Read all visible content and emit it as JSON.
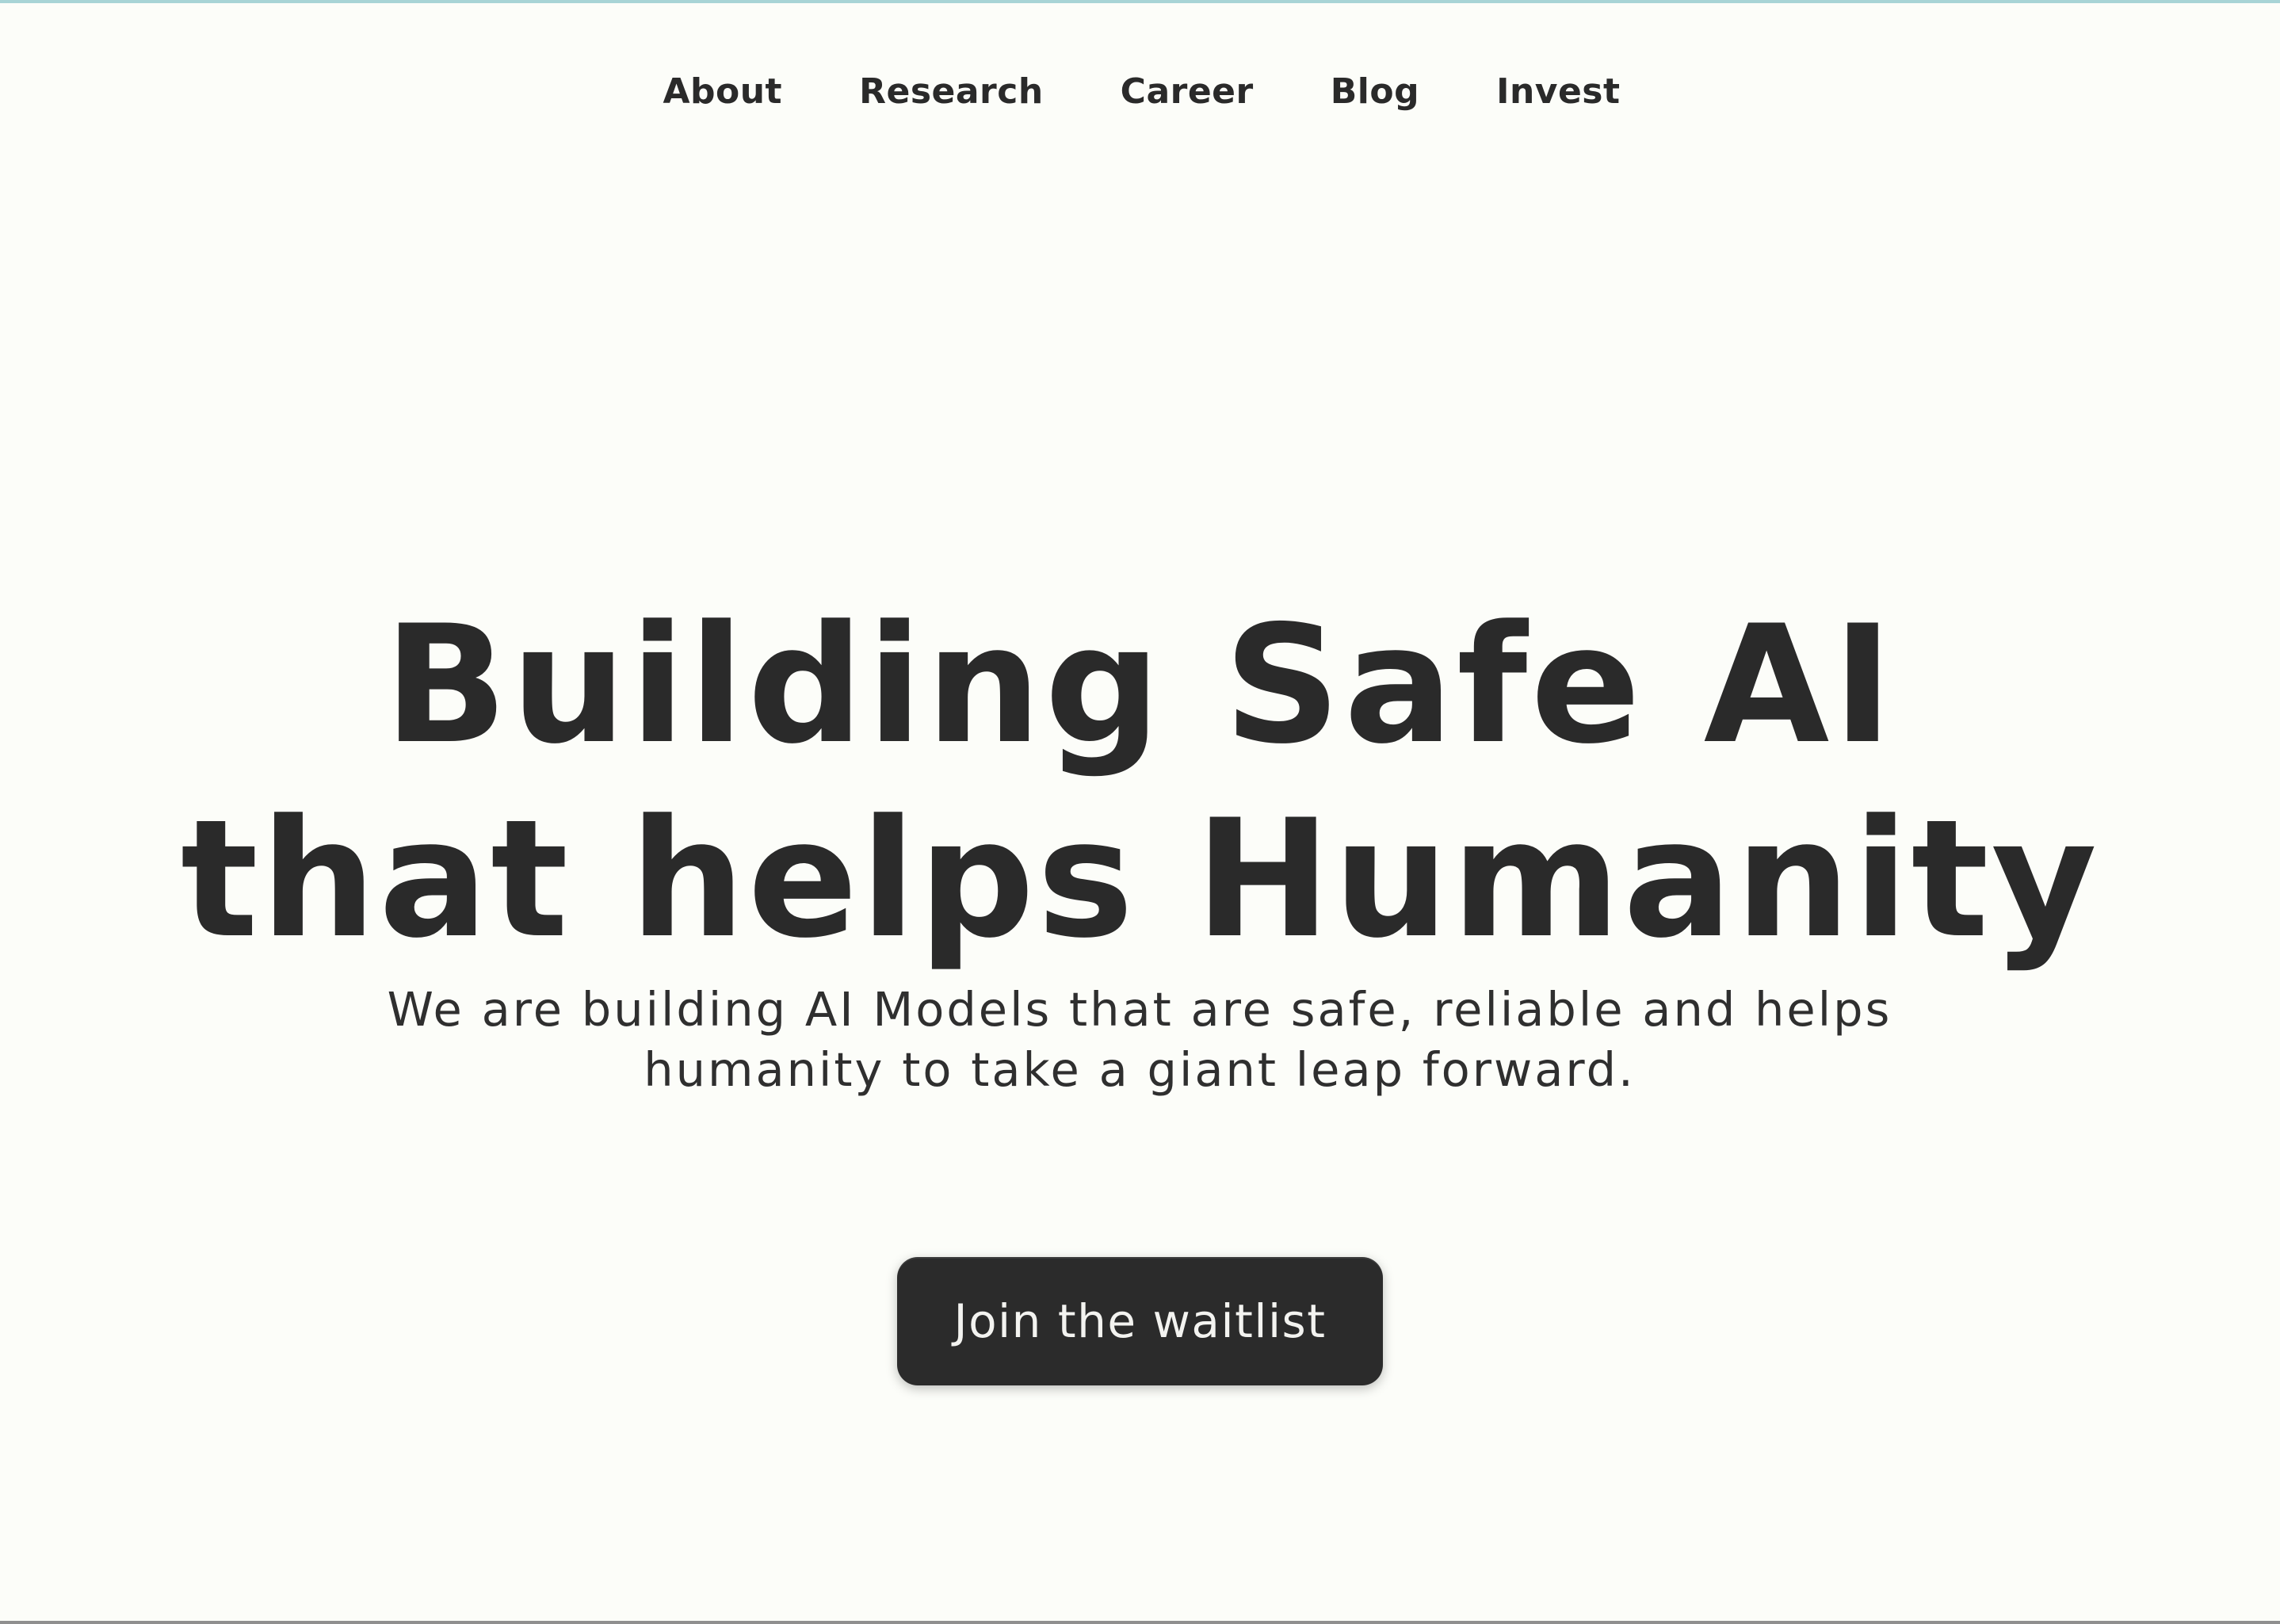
{
  "nav": {
    "items": [
      {
        "label": "About"
      },
      {
        "label": "Research"
      },
      {
        "label": "Career"
      },
      {
        "label": "Blog"
      },
      {
        "label": "Invest"
      }
    ]
  },
  "hero": {
    "headline_line1": "Building Safe AI",
    "headline_line2": "that helps Humanity",
    "subtitle": "We are building AI Models that are safe, reliable and helps humanity to take a giant leap forward.",
    "cta_label": "Join the waitlist"
  },
  "colors": {
    "background": "#fcfdf9",
    "text": "#2a2a2a",
    "button_bg": "#2b2b2b",
    "button_text": "#f3f3f0",
    "top_accent": "#a8d4d6"
  }
}
